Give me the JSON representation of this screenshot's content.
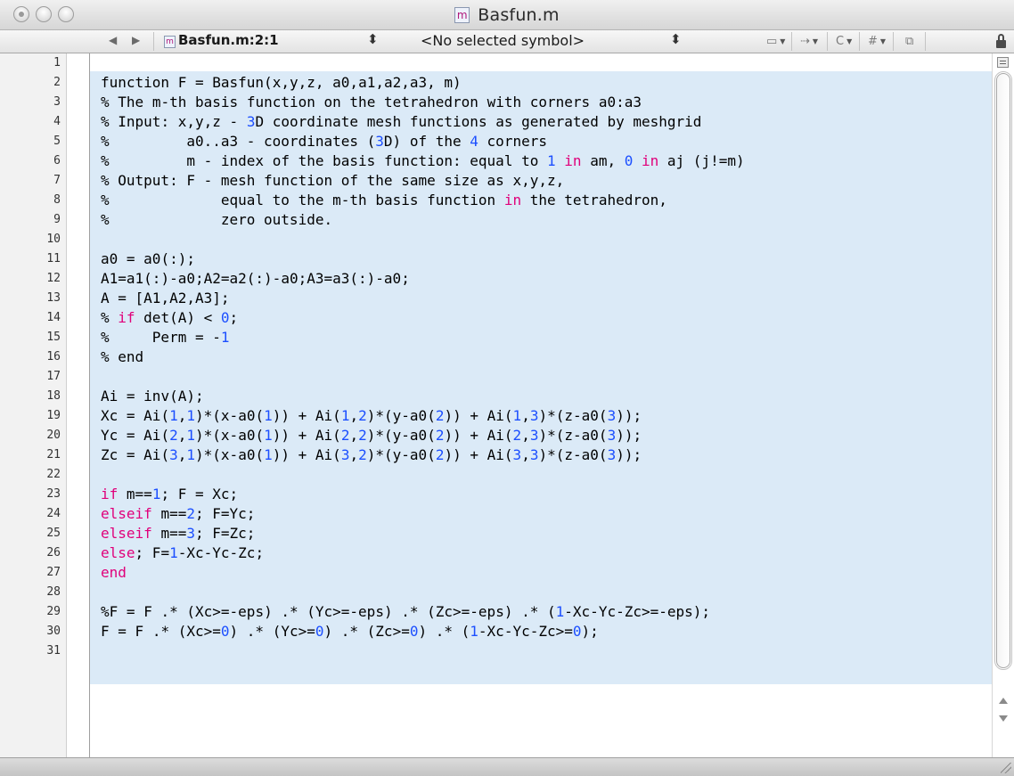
{
  "window": {
    "title": "Basfun.m",
    "file_icon_letter": "m"
  },
  "navbar": {
    "back_icon": "◀",
    "forward_icon": "▶",
    "path": "Basfun.m:2:1",
    "symbol": "<No selected symbol>",
    "updown_glyph": "⬍",
    "tools": [
      {
        "name": "bookmarks-menu",
        "glyph": "▭"
      },
      {
        "name": "breakpoints-menu",
        "glyph": "⇢"
      },
      {
        "name": "classes-menu",
        "glyph": "C"
      },
      {
        "name": "includes-menu",
        "glyph": "#"
      },
      {
        "name": "counterparts",
        "glyph": "⧉"
      }
    ]
  },
  "editor": {
    "language": "MATLAB",
    "line_numbers": [
      "1",
      "2",
      "3",
      "4",
      "5",
      "6",
      "7",
      "8",
      "9",
      "10",
      "11",
      "12",
      "13",
      "14",
      "15",
      "16",
      "17",
      "18",
      "19",
      "20",
      "21",
      "22",
      "23",
      "24",
      "25",
      "26",
      "27",
      "28",
      "29",
      "30",
      "31"
    ],
    "lines": [
      "",
      "function F = Basfun(x,y,z, a0,a1,a2,a3, m)",
      "% The m-th basis function on the tetrahedron with corners a0:a3",
      "% Input: x,y,z - 3D coordinate mesh functions as generated by meshgrid",
      "%         a0..a3 - coordinates (3D) of the 4 corners",
      "%         m - index of the basis function: equal to 1 in am, 0 in aj (j!=m)",
      "% Output: F - mesh function of the same size as x,y,z,",
      "%             equal to the m-th basis function in the tetrahedron,",
      "%             zero outside.",
      "",
      "a0 = a0(:);",
      "A1=a1(:)-a0;A2=a2(:)-a0;A3=a3(:)-a0;",
      "A = [A1,A2,A3];",
      "% if det(A) < 0;",
      "%     Perm = -1",
      "% end",
      "",
      "Ai = inv(A);",
      "Xc = Ai(1,1)*(x-a0(1)) + Ai(1,2)*(y-a0(2)) + Ai(1,3)*(z-a0(3));",
      "Yc = Ai(2,1)*(x-a0(1)) + Ai(2,2)*(y-a0(2)) + Ai(2,3)*(z-a0(3));",
      "Zc = Ai(3,1)*(x-a0(1)) + Ai(3,2)*(y-a0(2)) + Ai(3,3)*(z-a0(3));",
      "",
      "if m==1; F = Xc;",
      "elseif m==2; F=Yc;",
      "elseif m==3; F=Zc;",
      "else; F=1-Xc-Yc-Zc;",
      "end",
      "",
      "%F = F .* (Xc>=-eps) .* (Yc>=-eps) .* (Zc>=-eps) .* (1-Xc-Yc-Zc>=-eps);",
      "F = F .* (Xc>=0) .* (Yc>=0) .* (Zc>=0) .* (1-Xc-Yc-Zc>=0);",
      ""
    ]
  },
  "colors": {
    "code_background": "#dbeaf7",
    "keyword": "#e0007a",
    "number": "#1c4fff",
    "text": "#000000"
  }
}
